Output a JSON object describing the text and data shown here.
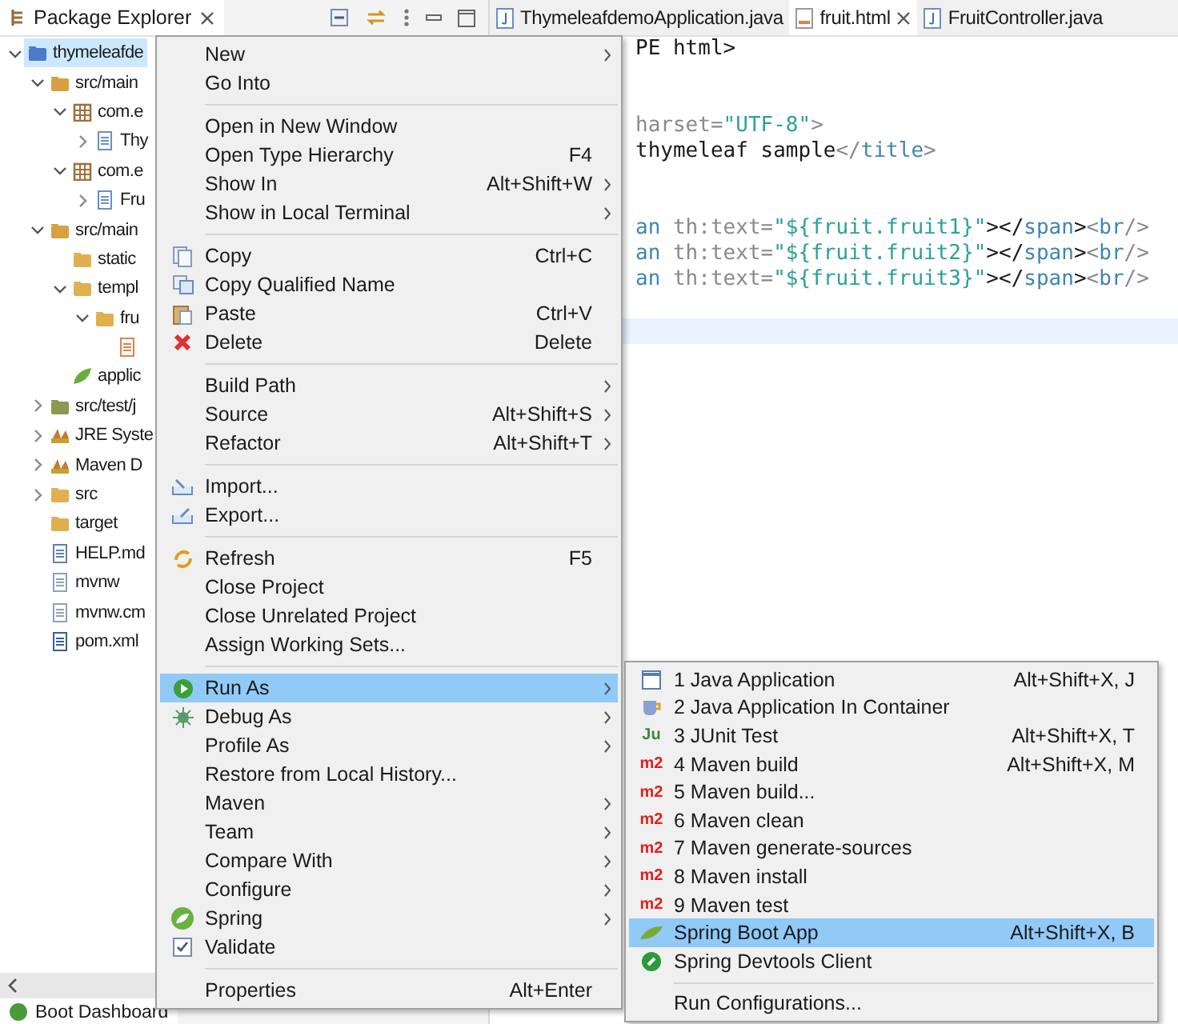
{
  "explorer": {
    "title": "Package Explorer",
    "tree": [
      {
        "label": "thymeleafde",
        "kind": "project",
        "expanded": true,
        "selected": true,
        "children": [
          {
            "label": "src/main",
            "kind": "source-folder",
            "expanded": true,
            "selected": false,
            "children": [
              {
                "label": "com.e",
                "kind": "package",
                "expanded": true,
                "selected": false,
                "children": [
                  {
                    "label": "Thy",
                    "kind": "java-file",
                    "expanded": false,
                    "selected": false
                  }
                ]
              },
              {
                "label": "com.e",
                "kind": "package",
                "expanded": true,
                "selected": false,
                "children": [
                  {
                    "label": "Fru",
                    "kind": "java-file",
                    "expanded": false,
                    "selected": false
                  }
                ]
              }
            ]
          },
          {
            "label": "src/main",
            "kind": "source-folder",
            "expanded": true,
            "selected": false,
            "children": [
              {
                "label": "static",
                "kind": "folder",
                "selected": false
              },
              {
                "label": "templ",
                "kind": "folder",
                "expanded": true,
                "selected": false,
                "children": [
                  {
                    "label": "fru",
                    "kind": "folder",
                    "expanded": true,
                    "selected": false,
                    "children": [
                      {
                        "kind": "html-file",
                        "selected": false
                      }
                    ]
                  }
                ]
              },
              {
                "label": "applic",
                "kind": "spring-file",
                "selected": false
              }
            ]
          },
          {
            "label": "src/test/j",
            "kind": "test-folder",
            "expanded": false,
            "selected": false
          },
          {
            "label": "JRE Syste",
            "kind": "library",
            "expanded": false,
            "selected": false
          },
          {
            "label": "Maven D",
            "kind": "library",
            "expanded": false,
            "selected": false
          },
          {
            "label": "src",
            "kind": "folder",
            "expanded": false,
            "selected": false
          },
          {
            "label": "target",
            "kind": "folder",
            "selected": false
          },
          {
            "label": "HELP.md",
            "kind": "doc-file",
            "selected": false
          },
          {
            "label": "mvnw",
            "kind": "file",
            "selected": false
          },
          {
            "label": "mvnw.cm",
            "kind": "file",
            "selected": false
          },
          {
            "label": "pom.xml",
            "kind": "maven-file",
            "selected": false
          }
        ]
      }
    ]
  },
  "editor": {
    "tabs": [
      {
        "label": "ThymeleafdemoApplication.java",
        "kind": "java",
        "selected": false
      },
      {
        "label": "fruit.html",
        "kind": "html",
        "selected": true
      },
      {
        "label": "FruitController.java",
        "kind": "java",
        "selected": false
      }
    ],
    "lines": [
      {
        "kind": "code",
        "segments": [
          {
            "kind": "text",
            "text": "PE html>"
          }
        ]
      },
      {
        "kind": "blank"
      },
      {
        "kind": "blank"
      },
      {
        "kind": "code",
        "segments": [
          {
            "kind": "attr",
            "text": "harset="
          },
          {
            "kind": "string",
            "text": "\"UTF-8\""
          },
          {
            "kind": "punct",
            "text": ">"
          }
        ]
      },
      {
        "kind": "code",
        "segments": [
          {
            "kind": "text",
            "text": "thymeleaf sample"
          },
          {
            "kind": "punct",
            "text": "</"
          },
          {
            "kind": "tag",
            "text": "title"
          },
          {
            "kind": "punct",
            "text": ">"
          }
        ]
      },
      {
        "kind": "blank"
      },
      {
        "kind": "blank"
      },
      {
        "kind": "code",
        "segments": [
          {
            "kind": "tag",
            "text": "an"
          },
          {
            "kind": "attr",
            "text": " th:text="
          },
          {
            "kind": "string",
            "text": "\"${fruit.fruit1}\""
          },
          {
            "kind": "text",
            "text": "></"
          },
          {
            "kind": "tag",
            "text": "span"
          },
          {
            "kind": "text",
            "text": ">"
          },
          {
            "kind": "punct",
            "text": "<"
          },
          {
            "kind": "tag",
            "text": "br"
          },
          {
            "kind": "punct",
            "text": "/>"
          }
        ]
      },
      {
        "kind": "code",
        "segments": [
          {
            "kind": "tag",
            "text": "an"
          },
          {
            "kind": "attr",
            "text": " th:text="
          },
          {
            "kind": "string",
            "text": "\"${fruit.fruit2}\""
          },
          {
            "kind": "text",
            "text": "></"
          },
          {
            "kind": "tag",
            "text": "span"
          },
          {
            "kind": "text",
            "text": ">"
          },
          {
            "kind": "punct",
            "text": "<"
          },
          {
            "kind": "tag",
            "text": "br"
          },
          {
            "kind": "punct",
            "text": "/>"
          }
        ]
      },
      {
        "kind": "code",
        "segments": [
          {
            "kind": "tag",
            "text": "an"
          },
          {
            "kind": "attr",
            "text": " th:text="
          },
          {
            "kind": "string",
            "text": "\"${fruit.fruit3}\""
          },
          {
            "kind": "text",
            "text": "></"
          },
          {
            "kind": "tag",
            "text": "span"
          },
          {
            "kind": "text",
            "text": ">"
          },
          {
            "kind": "punct",
            "text": "<"
          },
          {
            "kind": "tag",
            "text": "br"
          },
          {
            "kind": "punct",
            "text": "/>"
          }
        ]
      },
      {
        "kind": "blank"
      },
      {
        "kind": "current"
      }
    ]
  },
  "bottom_panel": {
    "title": "Boot Dashboard"
  },
  "context_menu": {
    "groups": [
      [
        {
          "label": "New",
          "submenu": true,
          "selected": false
        },
        {
          "label": "Go Into",
          "submenu": false,
          "selected": false
        }
      ],
      [
        {
          "label": "Open in New Window",
          "submenu": false,
          "selected": false
        },
        {
          "label": "Open Type Hierarchy",
          "shortcut": "F4",
          "submenu": false,
          "selected": false
        },
        {
          "label": "Show In",
          "shortcut": "Alt+Shift+W",
          "submenu": true,
          "selected": false
        },
        {
          "label": "Show in Local Terminal",
          "submenu": true,
          "selected": false
        }
      ],
      [
        {
          "label": "Copy",
          "shortcut": "Ctrl+C",
          "submenu": false,
          "selected": false
        },
        {
          "label": "Copy Qualified Name",
          "submenu": false,
          "selected": false
        },
        {
          "label": "Paste",
          "shortcut": "Ctrl+V",
          "submenu": false,
          "selected": false
        },
        {
          "label": "Delete",
          "shortcut": "Delete",
          "submenu": false,
          "selected": false
        }
      ],
      [
        {
          "label": "Build Path",
          "submenu": true,
          "selected": false
        },
        {
          "label": "Source",
          "shortcut": "Alt+Shift+S",
          "submenu": true,
          "selected": false
        },
        {
          "label": "Refactor",
          "shortcut": "Alt+Shift+T",
          "submenu": true,
          "selected": false
        }
      ],
      [
        {
          "label": "Import...",
          "submenu": false,
          "selected": false
        },
        {
          "label": "Export...",
          "submenu": false,
          "selected": false
        }
      ],
      [
        {
          "label": "Refresh",
          "shortcut": "F5",
          "submenu": false,
          "selected": false
        },
        {
          "label": "Close Project",
          "submenu": false,
          "selected": false
        },
        {
          "label": "Close Unrelated Project",
          "submenu": false,
          "selected": false
        },
        {
          "label": "Assign Working Sets...",
          "submenu": false,
          "selected": false
        }
      ],
      [
        {
          "label": "Run As",
          "submenu": true,
          "selected": true
        },
        {
          "label": "Debug As",
          "submenu": true,
          "selected": false
        },
        {
          "label": "Profile As",
          "submenu": true,
          "selected": false
        },
        {
          "label": "Restore from Local History...",
          "submenu": false,
          "selected": false
        },
        {
          "label": "Maven",
          "submenu": true,
          "selected": false
        },
        {
          "label": "Team",
          "submenu": true,
          "selected": false
        },
        {
          "label": "Compare With",
          "submenu": true,
          "selected": false
        },
        {
          "label": "Configure",
          "submenu": true,
          "selected": false
        },
        {
          "label": "Spring",
          "submenu": true,
          "selected": false
        },
        {
          "label": "Validate",
          "submenu": false,
          "selected": false
        }
      ],
      [
        {
          "label": "Properties",
          "shortcut": "Alt+Enter",
          "submenu": false,
          "selected": false
        }
      ]
    ]
  },
  "submenu": {
    "groups": [
      [
        {
          "label": "1 Java Application",
          "shortcut": "Alt+Shift+X, J",
          "selected": false
        },
        {
          "label": "2 Java Application In Container",
          "selected": false
        },
        {
          "label": "3 JUnit Test",
          "icon_text": "Ju",
          "shortcut": "Alt+Shift+X, T",
          "selected": false
        },
        {
          "label": "4 Maven build",
          "icon_text": "m2",
          "shortcut": "Alt+Shift+X, M",
          "selected": false
        },
        {
          "label": "5 Maven build...",
          "icon_text": "m2",
          "selected": false
        },
        {
          "label": "6 Maven clean",
          "icon_text": "m2",
          "selected": false
        },
        {
          "label": "7 Maven generate-sources",
          "icon_text": "m2",
          "selected": false
        },
        {
          "label": "8 Maven install",
          "icon_text": "m2",
          "selected": false
        },
        {
          "label": "9 Maven test",
          "icon_text": "m2",
          "selected": false
        },
        {
          "label": "Spring Boot App",
          "shortcut": "Alt+Shift+X, B",
          "selected": true
        },
        {
          "label": "Spring Devtools Client",
          "selected": false
        }
      ],
      [
        {
          "label": "Run Configurations...",
          "selected": false
        }
      ]
    ]
  }
}
